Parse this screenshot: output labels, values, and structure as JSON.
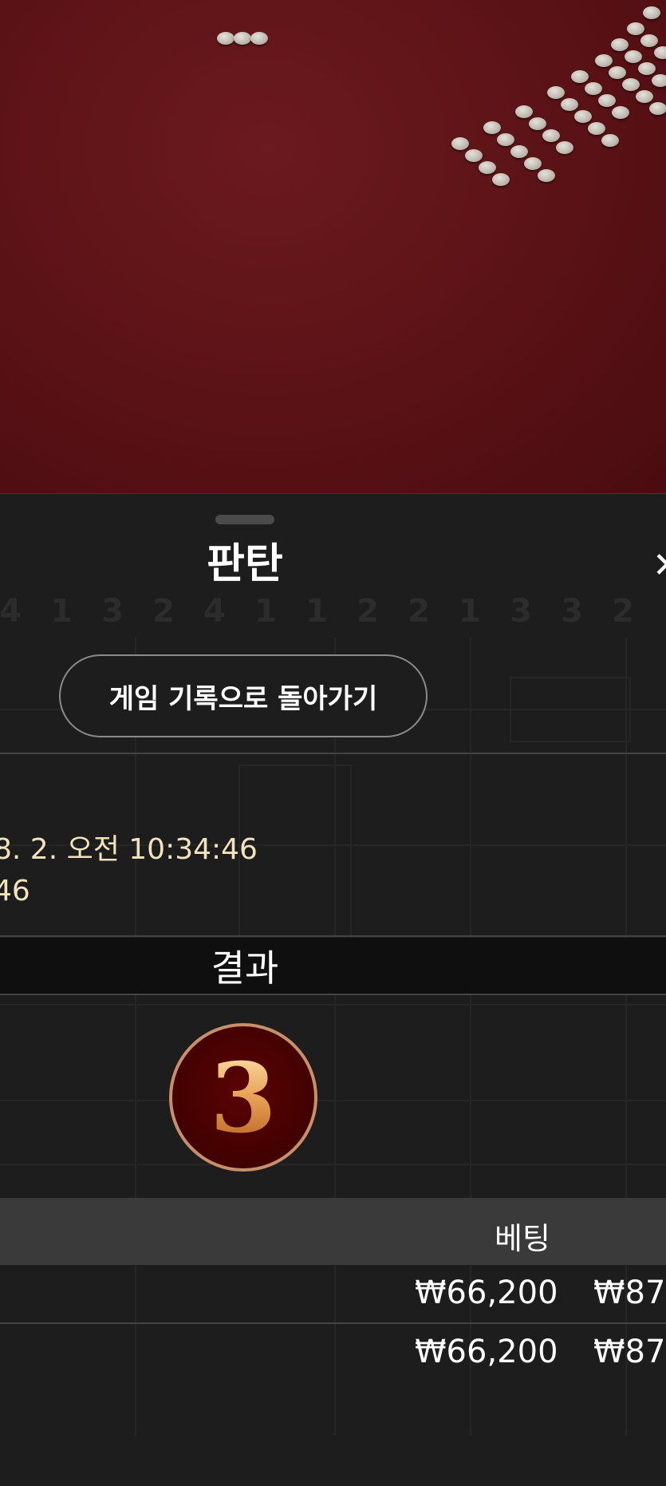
{
  "sheet": {
    "title": "판탄",
    "close_icon": "close-icon",
    "close_glyph": "✕",
    "back_button_label": "게임 기록으로 돌아가기",
    "ghost_numbers": [
      "4",
      "1",
      "3",
      "2",
      "4",
      "1",
      "1",
      "2",
      "2",
      "1",
      "3",
      "3",
      "2"
    ]
  },
  "round": {
    "datetime_line1": "8. 2. 오전 10:34:46",
    "datetime_line2": "46"
  },
  "result": {
    "label": "결과",
    "number": "3"
  },
  "bets": {
    "header_label": "베팅",
    "rows": [
      {
        "amount": "₩66,200",
        "amount_2": "₩87"
      },
      {
        "amount": "₩66,200",
        "amount_2": "₩87"
      }
    ]
  },
  "colors": {
    "table_felt": "#5a1216",
    "sheet_bg": "#1d1d1d",
    "datetime_text": "#f3e3bd",
    "result_badge_bg": "#3e0000",
    "result_badge_ring": "#c8906a",
    "result_number_gold": "#e6a056",
    "bet_header_bg": "#3a3a3a"
  }
}
